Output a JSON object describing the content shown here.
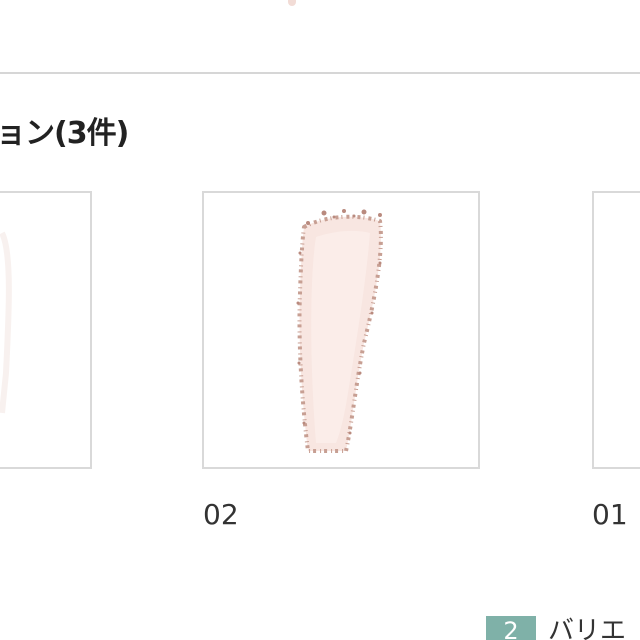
{
  "section": {
    "title": "ョン(3件)"
  },
  "swatches": [
    {
      "label": ""
    },
    {
      "label": "02"
    },
    {
      "label": "01"
    }
  ],
  "variation": {
    "number": "2",
    "label": "バリエ"
  },
  "colors": {
    "border": "#d9d9d9",
    "divider": "#d6d6d6",
    "powder_fill": "#f8e6e1",
    "powder_edge": "#c79f93",
    "tag_bg": "#7fb1a8"
  },
  "icons": [
    "powder-swatch-icon"
  ]
}
